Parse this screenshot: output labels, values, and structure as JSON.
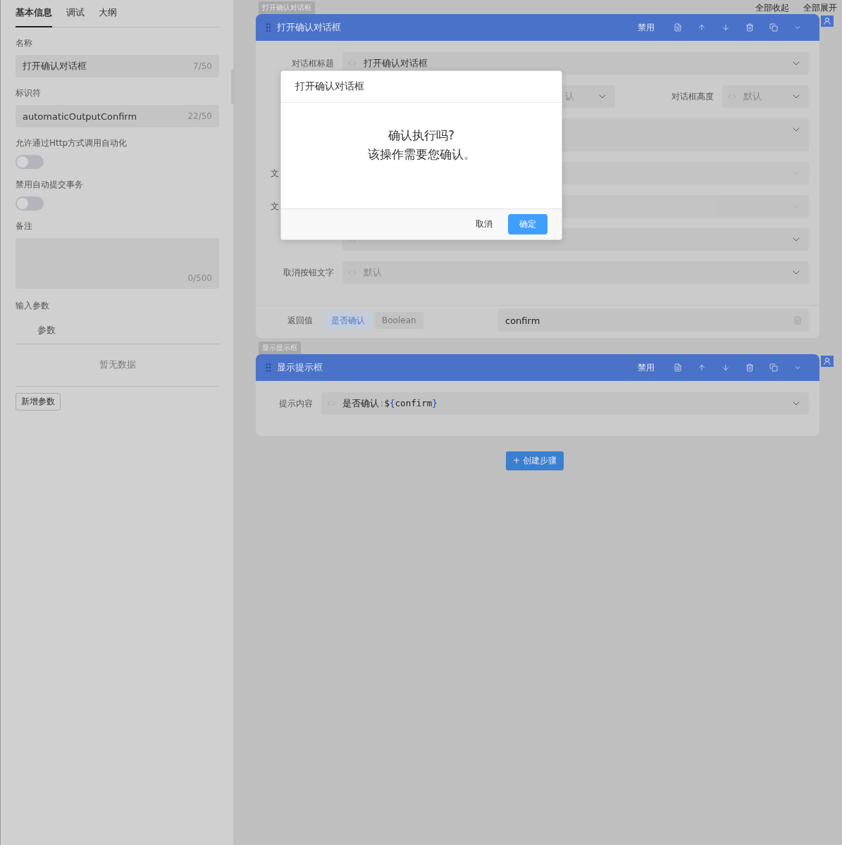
{
  "sidebar": {
    "tabs": [
      {
        "label": "基本信息",
        "selected": true
      },
      {
        "label": "调试",
        "selected": false
      },
      {
        "label": "大纲",
        "selected": false
      }
    ],
    "fields": [
      {
        "kind": "input",
        "label": "名称",
        "value": "打开确认对话框",
        "count": "7/50"
      },
      {
        "kind": "input",
        "label": "标识符",
        "value": "automaticOutputConfirm",
        "count": "22/50"
      },
      {
        "kind": "switch",
        "label": "允许通过Http方式调用自动化",
        "on": false
      },
      {
        "kind": "switch",
        "label": "禁用自动提交事务",
        "on": false
      },
      {
        "kind": "textarea",
        "label": "备注",
        "count": "0/500"
      }
    ],
    "params": {
      "label": "输入参数",
      "column": "参数",
      "empty": "暂无数据",
      "add_button": "新增参数"
    }
  },
  "toolbar": {
    "collapse_all": "全部收起",
    "expand_all": "全部展开"
  },
  "steps": [
    {
      "badge": "打开确认对话框",
      "title": "打开确认对话框",
      "disable_label": "禁用",
      "rows": [
        {
          "kind": "single",
          "label": "对话框标题",
          "value": "打开确认对话框",
          "disabled": false
        },
        {
          "kind": "pair",
          "placeholder": "认",
          "label_2": "对话框高度",
          "placeholder_2": "默认"
        },
        {
          "kind": "tall"
        },
        {
          "kind": "single",
          "label": "文",
          "disabled": true
        },
        {
          "kind": "single",
          "label": "文",
          "disabled": true
        },
        {
          "kind": "single",
          "disabled": false
        },
        {
          "kind": "single",
          "label": "取消按钮文字",
          "placeholder": "默认",
          "disabled": false
        }
      ],
      "return": {
        "label": "返回值",
        "tags": [
          {
            "text": "是否确认",
            "selected": true
          },
          {
            "text": "Boolean",
            "selected": false
          }
        ],
        "value": "confirm"
      }
    },
    {
      "badge": "显示提示框",
      "title": "显示提示框",
      "disable_label": "禁用",
      "rows": [
        {
          "kind": "code",
          "label": "提示内容",
          "segments": [
            {
              "text": "是否确认",
              "kind": "plain"
            },
            {
              "text": ":",
              "kind": "punct"
            },
            {
              "text": "$",
              "kind": "plain"
            },
            {
              "text": "{",
              "kind": "brace"
            },
            {
              "text": "confirm",
              "kind": "plain"
            },
            {
              "text": "}",
              "kind": "brace"
            }
          ]
        }
      ]
    }
  ],
  "create_button": "+ 创建步骤",
  "dialog": {
    "title": "打开确认对话框",
    "lines": [
      "确认执行吗?",
      "该操作需要您确认。"
    ],
    "cancel": "取消",
    "ok": "确定"
  }
}
